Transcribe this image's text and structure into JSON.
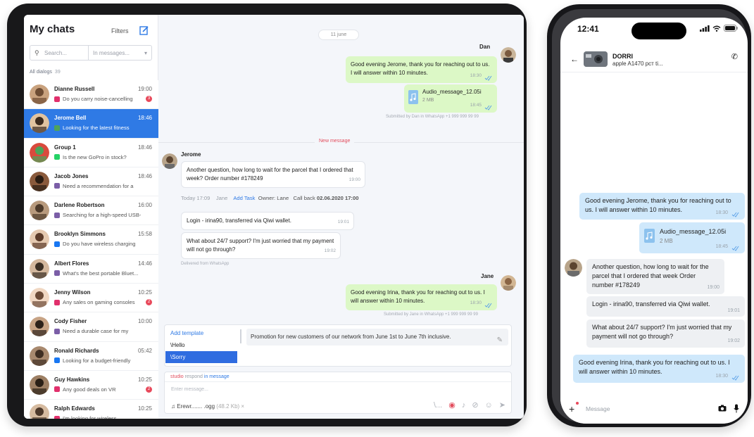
{
  "sidebar": {
    "title": "My chats",
    "filters": "Filters",
    "search_placeholder": "Search...",
    "search_scope": "In messages...",
    "all_dialogs_label": "All dialogs",
    "all_dialogs_count": "39",
    "chats": [
      {
        "name": "Dianne Russell",
        "time": "19:00",
        "preview": "Do you carry noise-cancelling",
        "channel": "instagram",
        "badge": "3",
        "active": false
      },
      {
        "name": "Jerome Bell",
        "time": "18:46",
        "preview": "Looking for the latest fitness",
        "channel": "sms",
        "badge": "",
        "active": true
      },
      {
        "name": "Group 1",
        "time": "18:46",
        "preview": "Is the new GoPro in stock?",
        "channel": "whatsapp",
        "badge": "",
        "active": false
      },
      {
        "name": "Jacob Jones",
        "time": "18:46",
        "preview": "Need a recommendation for a",
        "channel": "slack",
        "badge": "",
        "active": false
      },
      {
        "name": "Darlene Robertson",
        "time": "16:00",
        "preview": "Searching for a high-speed USB-",
        "channel": "slack",
        "badge": "",
        "active": false
      },
      {
        "name": "Brooklyn Simmons",
        "time": "15:58",
        "preview": "Do you have wireless charging",
        "channel": "facebook",
        "badge": "",
        "active": false
      },
      {
        "name": "Albert Flores",
        "time": "14:46",
        "preview": "What's the best portable Bluet...",
        "channel": "slack",
        "badge": "",
        "active": false
      },
      {
        "name": "Jenny Wilson",
        "time": "10:25",
        "preview": "Any sales on gaming consoles",
        "channel": "instagram",
        "badge": "2",
        "active": false
      },
      {
        "name": "Cody Fisher",
        "time": "10:00",
        "preview": "Need a durable case for my",
        "channel": "slack",
        "badge": "",
        "active": false
      },
      {
        "name": "Ronald Richards",
        "time": "05:42",
        "preview": "Looking for a budget-friendly",
        "channel": "facebook",
        "badge": "",
        "active": false
      },
      {
        "name": "Guy Hawkins",
        "time": "10:25",
        "preview": "Any good deals on VR",
        "channel": "instagram",
        "badge": "2",
        "active": false
      },
      {
        "name": "Ralph Edwards",
        "time": "10:25",
        "preview": "I'm looking for wireless",
        "channel": "instagram",
        "badge": "",
        "active": false
      }
    ]
  },
  "main": {
    "date": "11 june",
    "dan_sender": "Dan",
    "msg1_text": "Good evening Jerome, thank you for reaching out to us. I will answer within 10 minutes.",
    "msg1_time": "18:30",
    "audio_name": "Audio_message_12.05i",
    "audio_size": "2 MB",
    "audio_time": "18:45",
    "submitted_dan": "Submitted by Dan in WhatsApp +1 999 999 99 99",
    "new_message": "New message",
    "jerome_sender": "Jerome",
    "msg2_text": "Another question, how long to wait for the parcel that I ordered that week? Order number #178249",
    "msg2_time": "19:00",
    "task": {
      "today": "Today 17:09",
      "who": "Jane",
      "add_task": "Add Task",
      "owner": "Owner: Lane",
      "callback": "Call back",
      "callback_date": "02.06.2020 17:00"
    },
    "msg3_text": "Login - irina90, transferred via Qiwi wallet.",
    "msg3_time": "19:01",
    "msg4_text": "What about 24/7 support? I'm just worried that my payment will not go through?",
    "msg4_time": "19:02",
    "delivered": "Delivered from WhatsApp",
    "jane_sender": "Jane",
    "msg5_text": "Good evening Irina, thank you for reaching out to us. I will answer within 10 minutes.",
    "msg5_time": "18:30",
    "submitted_jane": "Submitted by Jane in WhatsApp +1 999 999 99 99",
    "templates": {
      "items": [
        "Add template",
        "\\Hello",
        "\\Sorry"
      ],
      "selected_index": 2,
      "text": "Promotion for new customers of our network from June 1st to June 7th inclusive."
    },
    "composer": {
      "hint_a": "studio",
      "hint_mid": "respond",
      "hint_b": "in message",
      "placeholder": "Enter message...",
      "file_name": "Erewr....... .ogg",
      "file_size": "(48.2 Kb)",
      "file_remove": "×",
      "slash": "\\..."
    }
  },
  "phone": {
    "time": "12:41",
    "contact": "DORRI",
    "subtitle": "apple A1470 рст ti...",
    "msg1_text": "Good evening Jerome, thank you for reaching out to us. I will answer within 10 minutes.",
    "msg1_time": "18:30",
    "audio_name": "Audio_message_12.05i",
    "audio_size": "2 MB",
    "audio_time": "18:45",
    "msg2_text": "Another question, how long to wait for the parcel that I ordered that week Order number #178249",
    "msg2_time": "19:00",
    "msg3_text": "Login - irina90, transferred via Qiwi wallet.",
    "msg3_time": "19:01",
    "msg4_text": "What about 24/7 support? I'm just worried that my payment will not go through?",
    "msg4_time": "19:02",
    "msg5_text": "Good evening Irina, thank you for reaching out to us. I will answer within 10 minutes.",
    "msg5_time": "18:30",
    "message_placeholder": "Message"
  },
  "colors": {
    "accent": "#2f7ae5",
    "outgoing": "#dcf8c6",
    "phone_outgoing": "#cfe8fb",
    "badge": "#e8495b"
  }
}
